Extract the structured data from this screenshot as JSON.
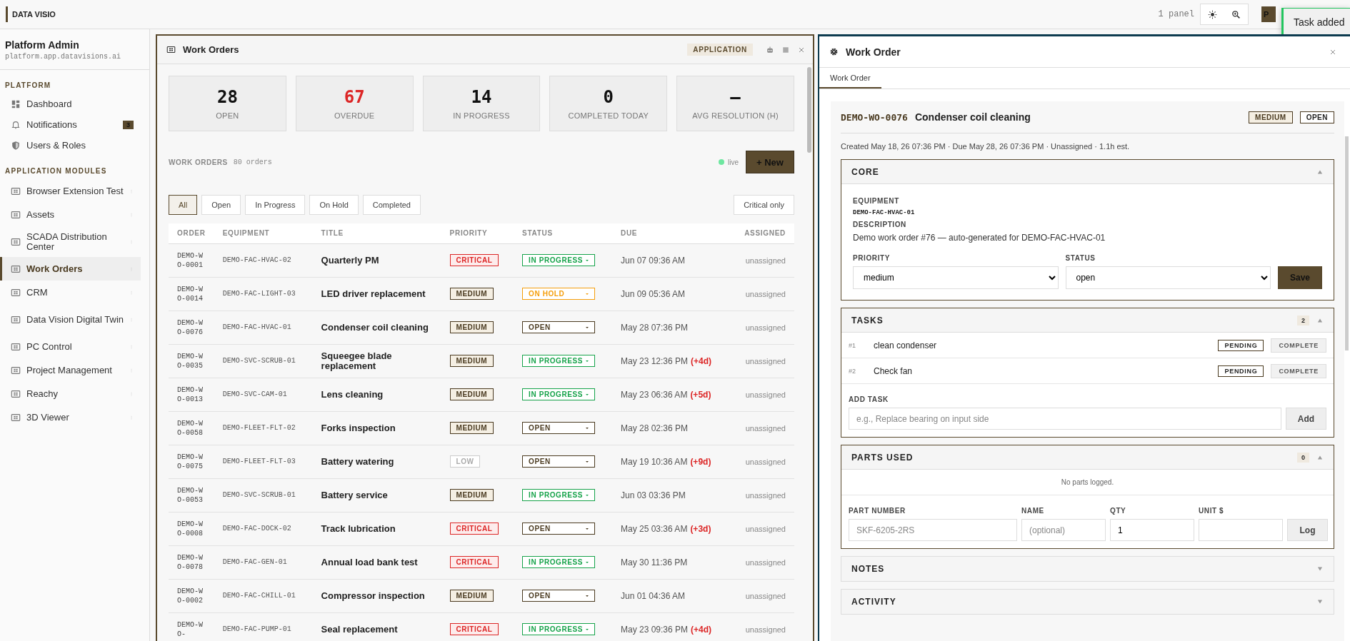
{
  "topbar": {
    "logo": "DATA VISIO",
    "panel_count": "1 panel",
    "avatar": "P"
  },
  "toast": {
    "message": "Task added"
  },
  "sidebar": {
    "user": "Platform Admin",
    "host": "platform.app.datavisions.ai",
    "sections": [
      {
        "title": "PLATFORM",
        "items": [
          {
            "label": "Dashboard",
            "kind": "dashboard",
            "selected": false
          },
          {
            "label": "Notifications",
            "kind": "bell",
            "badge": "3",
            "selected": false
          },
          {
            "label": "Users & Roles",
            "kind": "shield",
            "selected": false
          }
        ]
      },
      {
        "title": "APPLICATION MODULES",
        "items": [
          {
            "label": "Browser Extension Test",
            "kind": "module",
            "selected": false
          },
          {
            "label": "Assets",
            "kind": "module",
            "selected": false
          },
          {
            "label": "SCADA Distribution Center",
            "kind": "module",
            "selected": false
          },
          {
            "label": "Work Orders",
            "kind": "module",
            "selected": true
          },
          {
            "label": "CRM",
            "kind": "module",
            "selected": false
          },
          {
            "label": "Data Vision Digital Twin",
            "kind": "module",
            "selected": false
          },
          {
            "label": "PC Control",
            "kind": "module",
            "selected": false
          },
          {
            "label": "Project Management",
            "kind": "module",
            "selected": false
          },
          {
            "label": "Reachy",
            "kind": "module",
            "selected": false
          },
          {
            "label": "3D Viewer",
            "kind": "module",
            "selected": false
          }
        ]
      }
    ]
  },
  "work_orders": {
    "title": "Work Orders",
    "tag": "APPLICATION",
    "stats": [
      {
        "value": "28",
        "label": "OPEN",
        "alert": false
      },
      {
        "value": "67",
        "label": "OVERDUE",
        "alert": true
      },
      {
        "value": "14",
        "label": "IN PROGRESS",
        "alert": false
      },
      {
        "value": "0",
        "label": "COMPLETED TODAY",
        "alert": false
      },
      {
        "value": "–",
        "label": "AVG RESOLUTION (H)",
        "alert": false
      }
    ],
    "list_title": "WORK ORDERS",
    "list_count": "80 orders",
    "live": "live",
    "new_button": "+ New",
    "filters": [
      {
        "label": "All",
        "selected": true
      },
      {
        "label": "Open",
        "selected": false
      },
      {
        "label": "In Progress",
        "selected": false
      },
      {
        "label": "On Hold",
        "selected": false
      },
      {
        "label": "Completed",
        "selected": false
      }
    ],
    "critical_filter": {
      "label": "Critical only",
      "selected": false
    },
    "columns": [
      "ORDER",
      "EQUIPMENT",
      "TITLE",
      "PRIORITY",
      "STATUS",
      "DUE",
      "ASSIGNED"
    ],
    "rows": [
      {
        "order": "DEMO-WO-0001",
        "equipment": "DEMO-FAC-HVAC-02",
        "title": "Quarterly PM",
        "priority": {
          "label": "CRITICAL",
          "kind": "critical"
        },
        "status": {
          "label": "IN PROGRESS",
          "kind": "progress"
        },
        "due": "Jun 07 09:36 AM",
        "assigned": "unassigned"
      },
      {
        "order": "DEMO-WO-0014",
        "equipment": "DEMO-FAC-LIGHT-03",
        "title": "LED driver replacement",
        "priority": {
          "label": "MEDIUM",
          "kind": "medium"
        },
        "status": {
          "label": "ON HOLD",
          "kind": "hold"
        },
        "due": "Jun 09 05:36 AM",
        "assigned": "unassigned"
      },
      {
        "order": "DEMO-WO-0076",
        "equipment": "DEMO-FAC-HVAC-01",
        "title": "Condenser coil cleaning",
        "priority": {
          "label": "MEDIUM",
          "kind": "medium"
        },
        "status": {
          "label": "OPEN",
          "kind": "open"
        },
        "due": "May 28 07:36 PM",
        "assigned": "unassigned"
      },
      {
        "order": "DEMO-WO-0035",
        "equipment": "DEMO-SVC-SCRUB-01",
        "title": "Squeegee blade replacement",
        "priority": {
          "label": "MEDIUM",
          "kind": "medium"
        },
        "status": {
          "label": "IN PROGRESS",
          "kind": "progress"
        },
        "due": "May 23 12:36 PM",
        "overdue": "(+4d)",
        "assigned": "unassigned"
      },
      {
        "order": "DEMO-WO-0013",
        "equipment": "DEMO-SVC-CAM-01",
        "title": "Lens cleaning",
        "priority": {
          "label": "MEDIUM",
          "kind": "medium"
        },
        "status": {
          "label": "IN PROGRESS",
          "kind": "progress"
        },
        "due": "May 23 06:36 AM",
        "overdue": "(+5d)",
        "assigned": "unassigned"
      },
      {
        "order": "DEMO-WO-0058",
        "equipment": "DEMO-FLEET-FLT-02",
        "title": "Forks inspection",
        "priority": {
          "label": "MEDIUM",
          "kind": "medium"
        },
        "status": {
          "label": "OPEN",
          "kind": "open"
        },
        "due": "May 28 02:36 PM",
        "assigned": "unassigned"
      },
      {
        "order": "DEMO-WO-0075",
        "equipment": "DEMO-FLEET-FLT-03",
        "title": "Battery watering",
        "priority": {
          "label": "LOW",
          "kind": "low"
        },
        "status": {
          "label": "OPEN",
          "kind": "open"
        },
        "due": "May 19 10:36 AM",
        "overdue": "(+9d)",
        "assigned": "unassigned"
      },
      {
        "order": "DEMO-WO-0053",
        "equipment": "DEMO-SVC-SCRUB-01",
        "title": "Battery service",
        "priority": {
          "label": "MEDIUM",
          "kind": "medium"
        },
        "status": {
          "label": "IN PROGRESS",
          "kind": "progress"
        },
        "due": "Jun 03 03:36 PM",
        "assigned": "unassigned"
      },
      {
        "order": "DEMO-WO-0008",
        "equipment": "DEMO-FAC-DOCK-02",
        "title": "Track lubrication",
        "priority": {
          "label": "CRITICAL",
          "kind": "critical"
        },
        "status": {
          "label": "OPEN",
          "kind": "open"
        },
        "due": "May 25 03:36 AM",
        "overdue": "(+3d)",
        "assigned": "unassigned"
      },
      {
        "order": "DEMO-WO-0078",
        "equipment": "DEMO-FAC-GEN-01",
        "title": "Annual load bank test",
        "priority": {
          "label": "CRITICAL",
          "kind": "critical"
        },
        "status": {
          "label": "IN PROGRESS",
          "kind": "progress"
        },
        "due": "May 30 11:36 PM",
        "assigned": "unassigned"
      },
      {
        "order": "DEMO-WO-0002",
        "equipment": "DEMO-FAC-CHILL-01",
        "title": "Compressor inspection",
        "priority": {
          "label": "MEDIUM",
          "kind": "medium"
        },
        "status": {
          "label": "OPEN",
          "kind": "open"
        },
        "due": "Jun 01 04:36 AM",
        "assigned": "unassigned"
      },
      {
        "order": "DEMO-WO-",
        "equipment": "DEMO-FAC-PUMP-01",
        "title": "Seal replacement",
        "priority": {
          "label": "CRITICAL",
          "kind": "critical"
        },
        "status": {
          "label": "IN PROGRESS",
          "kind": "progress"
        },
        "due": "May 23 09:36 PM",
        "overdue": "(+4d)",
        "assigned": "unassigned"
      }
    ]
  },
  "detail": {
    "title": "Work Order",
    "tabs": [
      {
        "label": "Work Order",
        "selected": true
      }
    ],
    "order_id": "DEMO-WO-0076",
    "order_title": "Condenser coil cleaning",
    "badges": [
      "MEDIUM",
      "OPEN"
    ],
    "meta": "Created May 18, 26 07:36 PM · Due May 28, 26 07:36 PM · Unassigned · 1.1h est.",
    "core": {
      "title": "CORE",
      "expanded": true,
      "equipment_label": "EQUIPMENT",
      "equipment": "DEMO-FAC-HVAC-01",
      "description_label": "DESCRIPTION",
      "description": "Demo work order #76 — auto-generated for DEMO-FAC-HVAC-01",
      "priority_label": "PRIORITY",
      "priority": "medium",
      "status_label": "STATUS",
      "status": "open",
      "save_button": "Save"
    },
    "tasks": {
      "title": "TASKS",
      "count": "2",
      "expanded": true,
      "items": [
        {
          "number": "#1",
          "label": "clean condenser",
          "state": "PENDING",
          "action": "COMPLETE"
        },
        {
          "number": "#2",
          "label": "Check fan",
          "state": "PENDING",
          "action": "COMPLETE"
        }
      ],
      "add_label": "ADD TASK",
      "add_placeholder": "e.g., Replace bearing on input side",
      "add_button": "Add"
    },
    "parts": {
      "title": "PARTS USED",
      "count": "0",
      "expanded": true,
      "empty": "No parts logged.",
      "fields": [
        {
          "label": "PART NUMBER",
          "placeholder": "SKF-6205-2RS"
        },
        {
          "label": "NAME",
          "placeholder": "(optional)"
        },
        {
          "label": "QTY",
          "value": "1"
        },
        {
          "label": "UNIT $"
        }
      ],
      "log_button": "Log"
    },
    "notes": {
      "title": "NOTES",
      "expanded": false
    },
    "activity": {
      "title": "ACTIVITY",
      "expanded": false
    }
  }
}
